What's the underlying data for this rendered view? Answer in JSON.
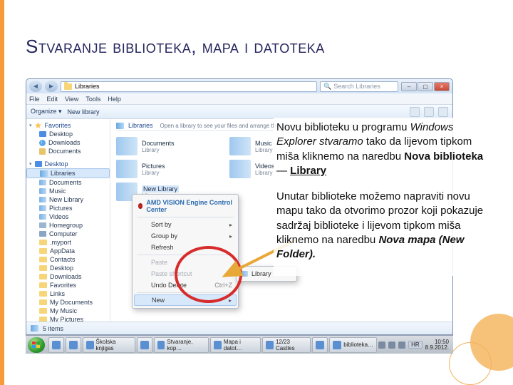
{
  "slide": {
    "title": "Stvaranje biblioteka, mapa i datoteka",
    "para1_a": "Novu biblioteku u programu ",
    "para1_em": "Windows Explorer stvaramo",
    "para1_b": " tako da lijevom tipkom miša kliknemo na naredbu ",
    "para1_strong1": "Nova biblioteka",
    "para1_dash": " — ",
    "para1_strong2": "Library",
    "para2_a": "Unutar biblioteke možemo napraviti novu mapu tako da otvorimo prozor koji pokazuje sadržaj biblioteke i lijevom tipkom miša kliknemo na naredbu ",
    "para2_strong": "Nova mapa (New Folder)."
  },
  "explorer": {
    "address": "Libraries",
    "search_placeholder": "Search Libraries",
    "menu": [
      "File",
      "Edit",
      "View",
      "Tools",
      "Help"
    ],
    "toolbar": {
      "organize": "Organize ▾",
      "newlib": "New library"
    },
    "content": {
      "title": "Libraries",
      "subtitle": "Open a library to see your files and arrange them by folder, date, and other properties."
    },
    "nav": {
      "favorites": "Favorites",
      "fav_items": [
        "Desktop",
        "Downloads",
        "Documents"
      ],
      "desktop": "Desktop",
      "desk_items": [
        "Libraries",
        "Documents",
        "Music",
        "New Library",
        "Pictures",
        "Videos",
        "Homegroup",
        "Computer"
      ],
      "collapsed": [
        ".myport",
        "AppData",
        "Contacts",
        "Desktop",
        "Downloads",
        "Favorites",
        "Links",
        "My Documents",
        "My Music",
        "My Pictures"
      ]
    },
    "libs": [
      {
        "name": "Documents",
        "sub": "Library"
      },
      {
        "name": "Music",
        "sub": "Library"
      },
      {
        "name": "Pictures",
        "sub": "Library"
      },
      {
        "name": "Videos",
        "sub": "Library"
      },
      {
        "name": "New Library",
        "sub": "Library"
      }
    ],
    "status": "5 items"
  },
  "context_menu": {
    "header": "AMD VISION Engine Control Center",
    "items": [
      {
        "label": "Sort by",
        "arrow": true
      },
      {
        "label": "Group by",
        "arrow": true
      },
      {
        "label": "Refresh"
      },
      {
        "sep": true
      },
      {
        "label": "Paste",
        "disabled": true
      },
      {
        "label": "Paste shortcut",
        "disabled": true
      },
      {
        "label": "Undo Delete",
        "shortcut": "Ctrl+Z"
      },
      {
        "sep": true
      },
      {
        "label": "New",
        "arrow": true,
        "hover": true
      }
    ],
    "submenu": {
      "label": "Library"
    }
  },
  "taskbar": {
    "items": [
      "",
      "",
      "Školska knjigas",
      "",
      "Stvaranje, kop…",
      "Mapa i datot…",
      "12/23 Castles",
      "",
      "biblioteka…"
    ],
    "lang": "HR",
    "time": "10:50",
    "date": "8.9.2012."
  }
}
